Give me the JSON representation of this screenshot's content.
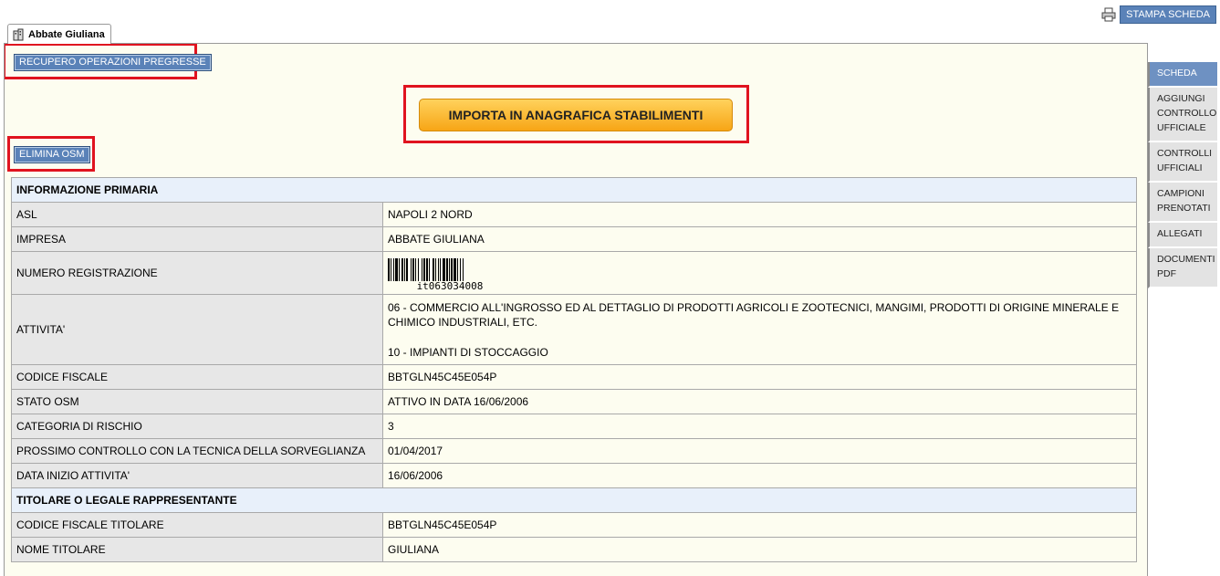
{
  "header": {
    "print_label": "STAMPA SCHEDA"
  },
  "tab": {
    "label": "Abbate Giuliana"
  },
  "buttons": {
    "recupero": "RECUPERO OPERAZIONI PREGRESSE",
    "importa": "IMPORTA IN ANAGRAFICA STABILIMENTI",
    "elimina": "ELIMINA OSM"
  },
  "sidebar": {
    "items": [
      {
        "label": "SCHEDA",
        "active": true
      },
      {
        "label": "AGGIUNGI CONTROLLO UFFICIALE"
      },
      {
        "label": "CONTROLLI UFFICIALI"
      },
      {
        "label": "CAMPIONI PRENOTATI"
      },
      {
        "label": "ALLEGATI"
      },
      {
        "label": "DOCUMENTI PDF"
      }
    ]
  },
  "info": {
    "section1": "INFORMAZIONE PRIMARIA",
    "asl_label": "ASL",
    "asl": "NAPOLI 2 NORD",
    "impresa_label": "IMPRESA",
    "impresa": "ABBATE GIULIANA",
    "numreg_label": "NUMERO REGISTRAZIONE",
    "numreg": "it063034008",
    "attivita_label": "ATTIVITA'",
    "attivita_1": "06 - COMMERCIO ALL'INGROSSO ED AL DETTAGLIO DI PRODOTTI AGRICOLI E ZOOTECNICI, MANGIMI, PRODOTTI DI ORIGINE MINERALE E CHIMICO INDUSTRIALI, ETC.",
    "attivita_2": "10 - IMPIANTI DI STOCCAGGIO",
    "cf_label": "CODICE FISCALE",
    "cf": "BBTGLN45C45E054P",
    "stato_label": "STATO OSM",
    "stato": "ATTIVO IN DATA 16/06/2006",
    "rischio_label": "CATEGORIA DI RISCHIO",
    "rischio": "3",
    "prossimo_label": "PROSSIMO CONTROLLO CON LA TECNICA DELLA SORVEGLIANZA",
    "prossimo": "01/04/2017",
    "inizio_label": "DATA INIZIO ATTIVITA'",
    "inizio": "16/06/2006",
    "section2": "TITOLARE O LEGALE RAPPRESENTANTE",
    "cft_label": "CODICE FISCALE TITOLARE",
    "cft": "BBTGLN45C45E054P",
    "nome_label": "NOME TITOLARE",
    "nome": "GIULIANA"
  }
}
